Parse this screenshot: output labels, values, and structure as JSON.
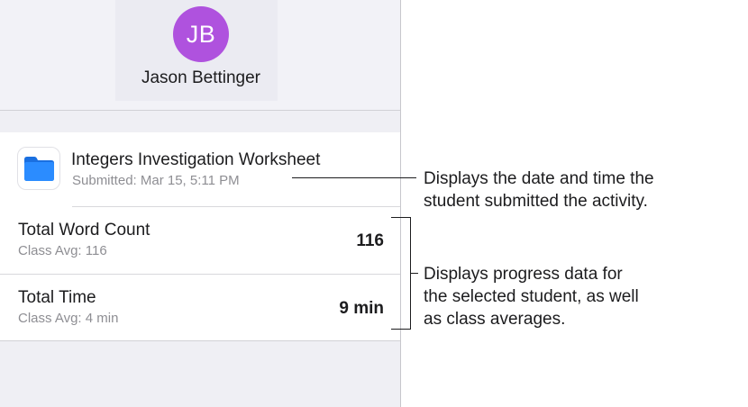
{
  "profile": {
    "initials": "JB",
    "name": "Jason Bettinger",
    "avatar_color": "#af52de"
  },
  "activity": {
    "icon": "folder-icon",
    "icon_color": "#1a7cf5",
    "title": "Integers Investigation Worksheet",
    "submitted": "Submitted: Mar 15, 5:11 PM"
  },
  "metrics": [
    {
      "label": "Total Word Count",
      "class_avg": "Class Avg: 116",
      "value": "116"
    },
    {
      "label": "Total Time",
      "class_avg": "Class Avg: 4 min",
      "value": "9 min"
    }
  ],
  "callouts": {
    "submission": [
      "Displays the date and time the",
      "student submitted the activity."
    ],
    "progress": [
      "Displays progress data for",
      "the selected student, as well",
      "as class averages."
    ]
  }
}
